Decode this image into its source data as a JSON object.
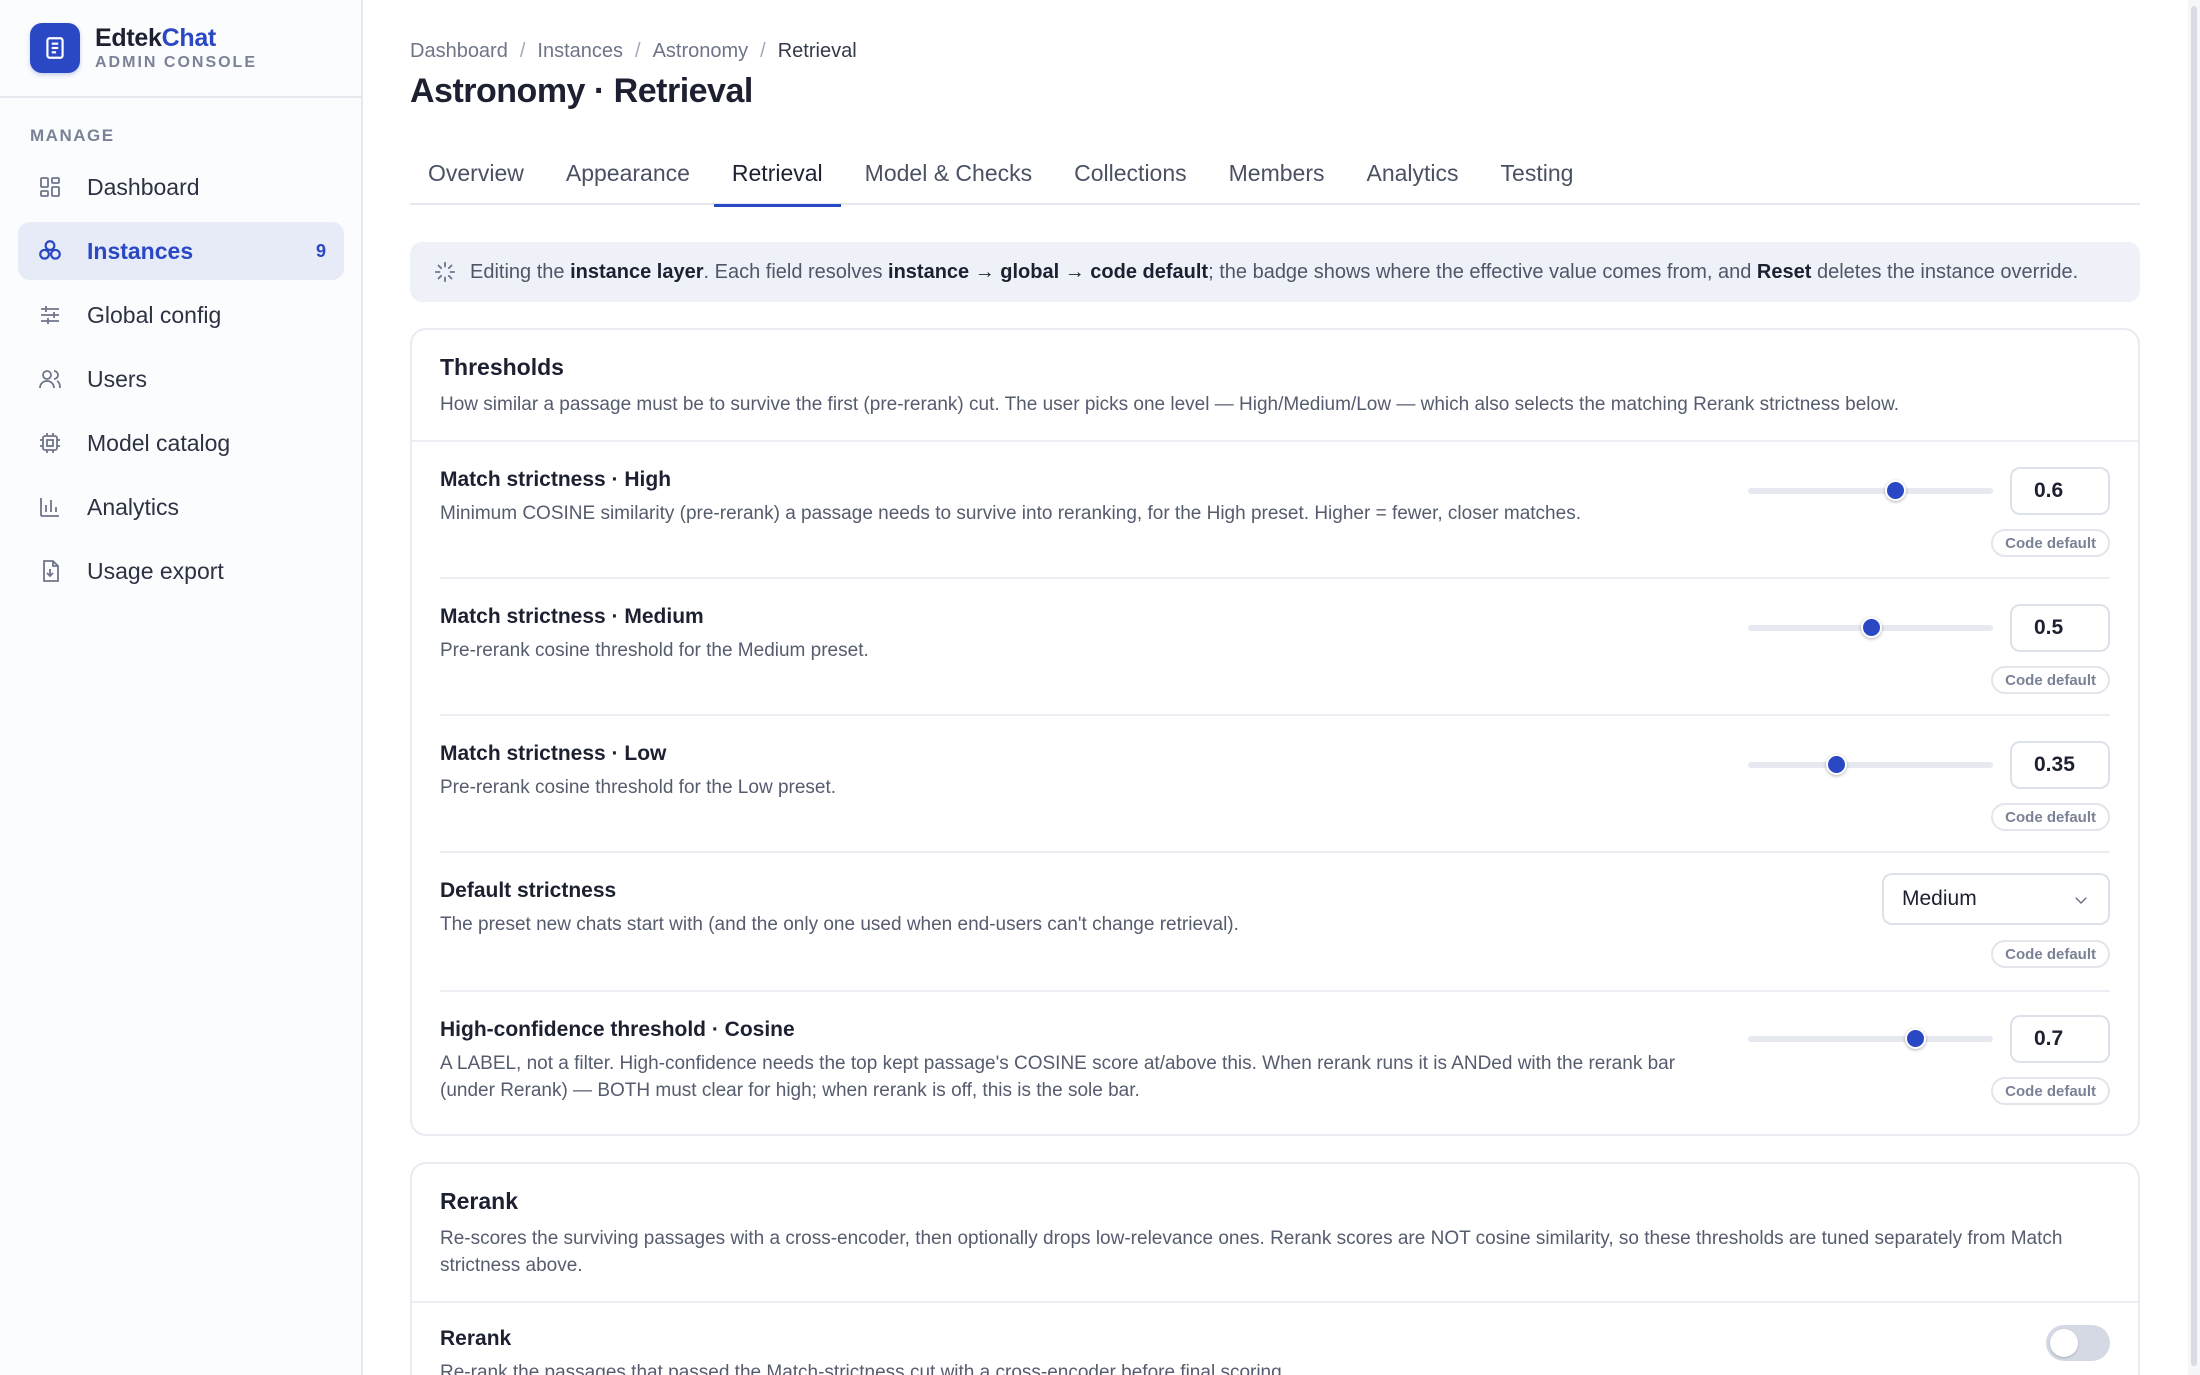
{
  "brand": {
    "name_part1": "Edtek",
    "name_part2": "Chat",
    "subtitle": "ADMIN CONSOLE"
  },
  "sidebar": {
    "section_label": "MANAGE",
    "items": [
      {
        "label": "Dashboard",
        "icon": "grid-icon",
        "active": false
      },
      {
        "label": "Instances",
        "icon": "instances-icon",
        "active": true,
        "count": "9"
      },
      {
        "label": "Global config",
        "icon": "sliders-icon",
        "active": false
      },
      {
        "label": "Users",
        "icon": "users-icon",
        "active": false
      },
      {
        "label": "Model catalog",
        "icon": "chip-icon",
        "active": false
      },
      {
        "label": "Analytics",
        "icon": "bar-chart-icon",
        "active": false
      },
      {
        "label": "Usage export",
        "icon": "file-download-icon",
        "active": false
      }
    ]
  },
  "breadcrumb": [
    "Dashboard",
    "Instances",
    "Astronomy",
    "Retrieval"
  ],
  "page_title": "Astronomy · Retrieval",
  "tabs": [
    {
      "label": "Overview",
      "active": false
    },
    {
      "label": "Appearance",
      "active": false
    },
    {
      "label": "Retrieval",
      "active": true
    },
    {
      "label": "Model & Checks",
      "active": false
    },
    {
      "label": "Collections",
      "active": false
    },
    {
      "label": "Members",
      "active": false
    },
    {
      "label": "Analytics",
      "active": false
    },
    {
      "label": "Testing",
      "active": false
    }
  ],
  "banner": {
    "t1": "Editing the ",
    "b1": "instance layer",
    "t2": ". Each field resolves ",
    "b2": "instance → global → code default",
    "t3": "; the badge shows where the effective value comes from, and ",
    "b3": "Reset",
    "t4": " deletes the instance override."
  },
  "thresholds": {
    "title": "Thresholds",
    "description": "How similar a passage must be to survive the first (pre-rerank) cut. The user picks one level — High/Medium/Low — which also selects the matching Rerank strictness below.",
    "rows": [
      {
        "title": "Match strictness · High",
        "description": "Minimum COSINE similarity (pre-rerank) a passage needs to survive into reranking, for the High preset. Higher = fewer, closer matches.",
        "value": "0.6",
        "slider_fraction": 0.6,
        "badge": "Code default"
      },
      {
        "title": "Match strictness · Medium",
        "description": "Pre-rerank cosine threshold for the Medium preset.",
        "value": "0.5",
        "slider_fraction": 0.5,
        "badge": "Code default"
      },
      {
        "title": "Match strictness · Low",
        "description": "Pre-rerank cosine threshold for the Low preset.",
        "value": "0.35",
        "slider_fraction": 0.36,
        "badge": "Code default"
      },
      {
        "title": "Default strictness",
        "description": "The preset new chats start with (and the only one used when end-users can't change retrieval).",
        "select_value": "Medium",
        "badge": "Code default"
      },
      {
        "title": "High-confidence threshold · Cosine",
        "description": "A LABEL, not a filter. High-confidence needs the top kept passage's COSINE score at/above this. When rerank runs it is ANDed with the rerank bar (under Rerank) — BOTH must clear for high; when rerank is off, this is the sole bar.",
        "value": "0.7",
        "slider_fraction": 0.68,
        "badge": "Code default"
      }
    ]
  },
  "rerank": {
    "title": "Rerank",
    "description": "Re-scores the surviving passages with a cross-encoder, then optionally drops low-relevance ones. Rerank scores are NOT cosine similarity, so these thresholds are tuned separately from Match strictness above.",
    "toggle_row": {
      "title": "Rerank",
      "description": "Re-rank the passages that passed the Match-strictness cut with a cross-encoder before final scoring.",
      "enabled": false
    }
  },
  "colors": {
    "accent": "#2a47c4",
    "active_nav_bg": "#e6ebf7",
    "banner_bg": "#eef1f8"
  }
}
